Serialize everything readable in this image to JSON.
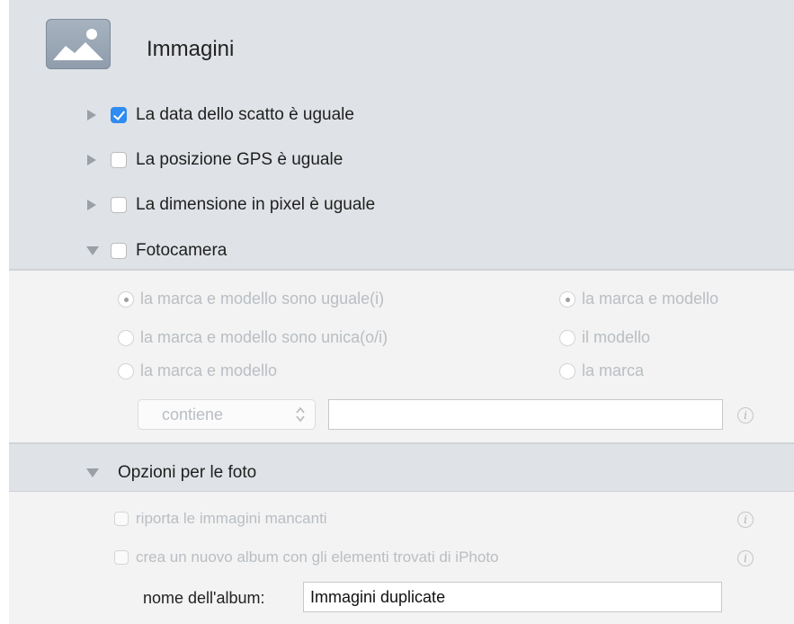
{
  "header": {
    "title": "Immagini",
    "icon": "image-icon"
  },
  "criteria": [
    {
      "label": "La data dello scatto è uguale",
      "checked": true,
      "expanded": false
    },
    {
      "label": "La posizione GPS è uguale",
      "checked": false,
      "expanded": false
    },
    {
      "label": "La dimensione in pixel è uguale",
      "checked": false,
      "expanded": false
    },
    {
      "label": "Fotocamera",
      "checked": false,
      "expanded": true
    }
  ],
  "camera": {
    "left_options": [
      {
        "label": "la marca e modello sono uguale(i)",
        "selected": true
      },
      {
        "label": "la marca e modello sono unica(o/i)",
        "selected": false
      },
      {
        "label": "la marca e modello",
        "selected": false
      }
    ],
    "right_options": [
      {
        "label": "la marca e modello",
        "selected": true
      },
      {
        "label": "il modello",
        "selected": false
      },
      {
        "label": "la marca",
        "selected": false
      }
    ],
    "operator": "contiene",
    "value": ""
  },
  "photo_options": {
    "title": "Opzioni per le foto",
    "report_missing": "riporta le immagini mancanti",
    "create_album": "crea un nuovo album con gli elementi trovati di iPhoto",
    "album_name_label": "nome dell'album:",
    "album_name_value": "Immagini duplicate"
  },
  "colors": {
    "accent": "#2f8cf0",
    "section_bg": "#dfe2e6",
    "disabled_bg": "#f3f3f3"
  }
}
